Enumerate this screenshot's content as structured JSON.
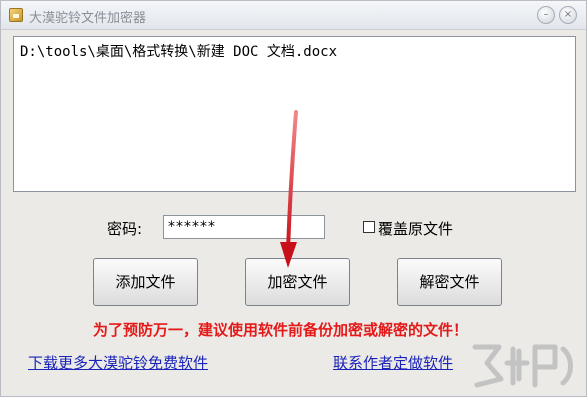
{
  "window": {
    "title": "大漠驼铃文件加密器",
    "controls": {
      "minimize": "–",
      "close": "×"
    }
  },
  "file_list": {
    "value": "D:\\tools\\桌面\\格式转换\\新建 DOC 文档.docx"
  },
  "password": {
    "label": "密码:",
    "value": "******"
  },
  "overwrite": {
    "label": "覆盖原文件",
    "checked": false
  },
  "buttons": {
    "add": "添加文件",
    "encrypt": "加密文件",
    "decrypt": "解密文件"
  },
  "warning": "为了预防万一，建议使用软件前备份加密或解密的文件！",
  "links": {
    "download": "下载更多大漠驼铃免费软件",
    "contact": "联系作者定做软件"
  },
  "colors": {
    "warning": "#e41a1a",
    "link": "#1a24b8",
    "arrow": "#c8101a"
  }
}
